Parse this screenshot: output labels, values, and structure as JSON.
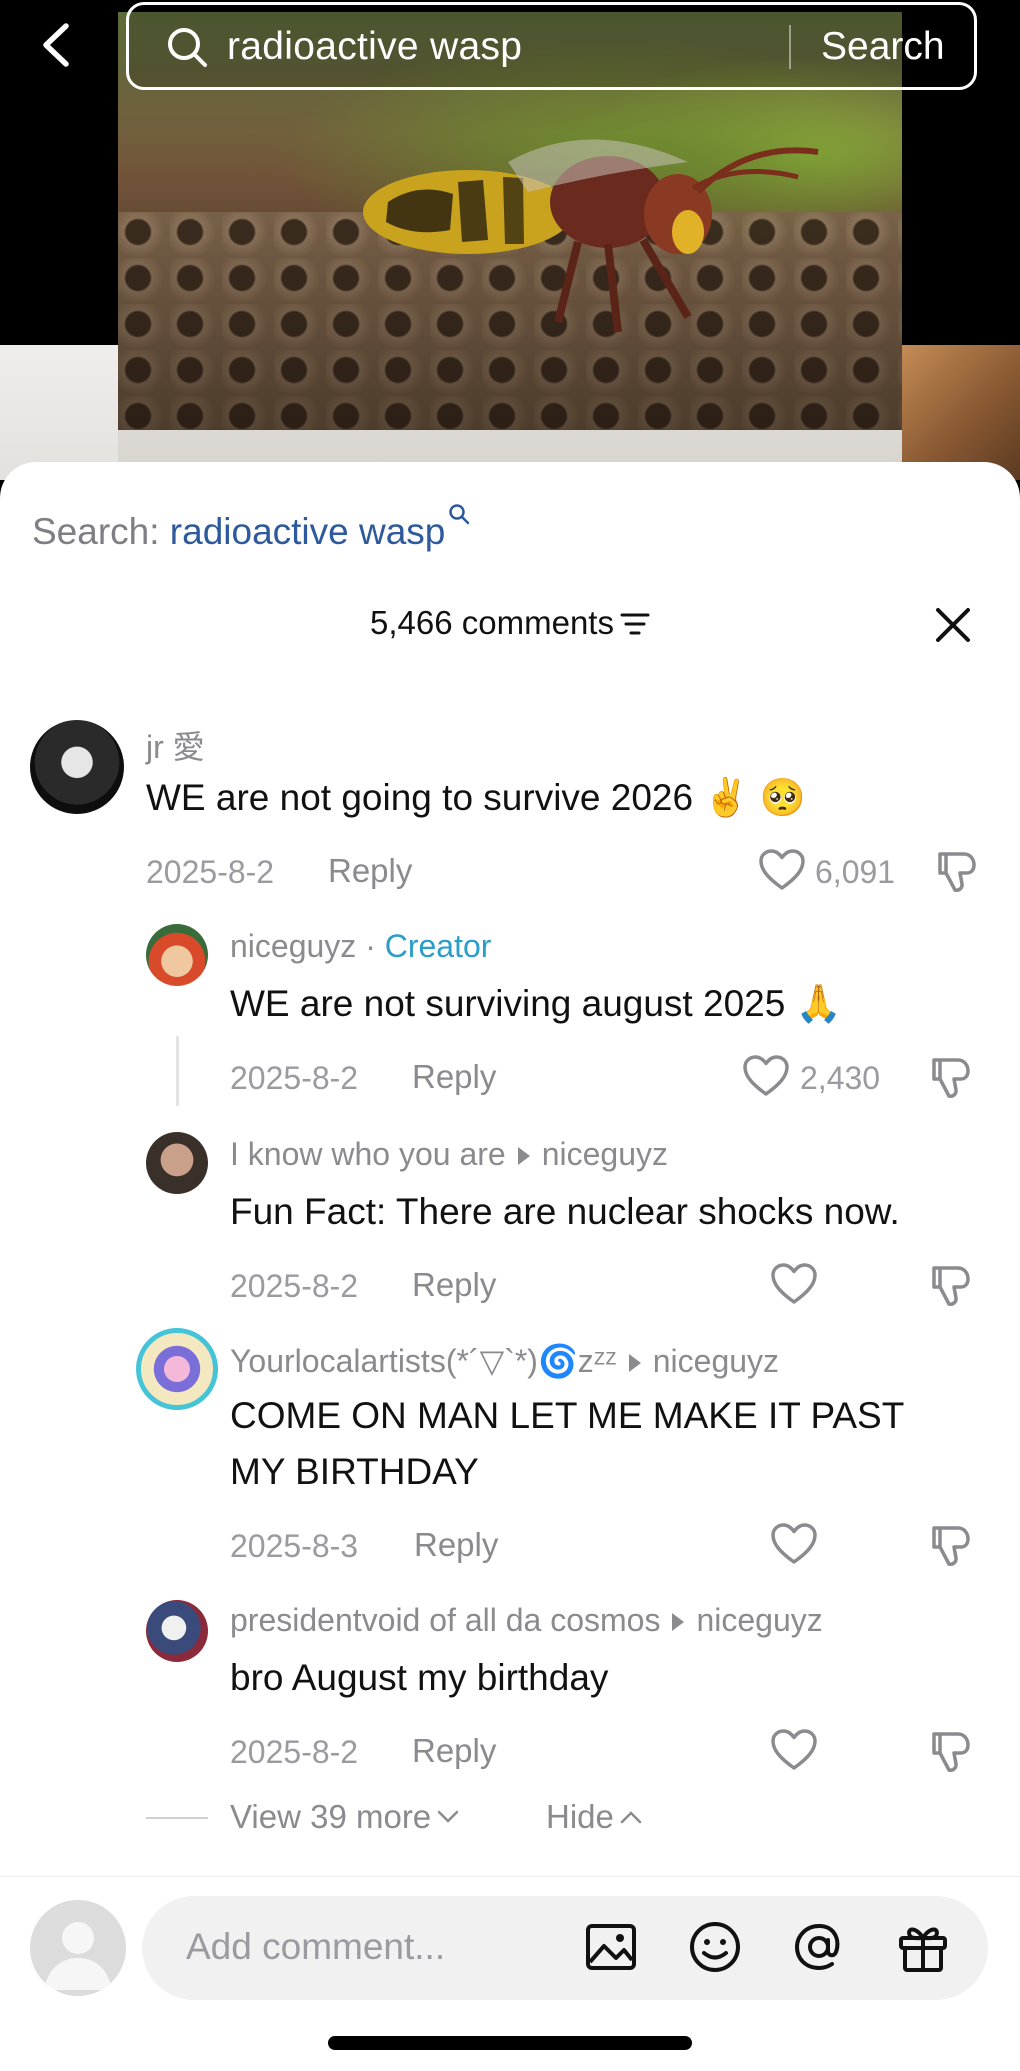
{
  "search": {
    "query": "radioactive wasp",
    "button_label": "Search"
  },
  "sheet": {
    "suggest_prefix": "Search: ",
    "suggest_term": "radioactive wasp",
    "comments_count_label": "5,466 comments"
  },
  "comments": [
    {
      "user": "jr 愛",
      "text": "WE are not going to survive 2026 ✌️ 🥺",
      "date": "2025-8-2",
      "reply_label": "Reply",
      "likes": "6,091"
    },
    {
      "user": "niceguyz",
      "badge": "Creator",
      "separator": " · ",
      "text": "WE are not surviving august 2025 🙏",
      "date": "2025-8-2",
      "reply_label": "Reply",
      "likes": "2,430"
    },
    {
      "user": "I know who you are",
      "reply_to": "niceguyz",
      "text": "Fun Fact: There are nuclear shocks now.",
      "date": "2025-8-2",
      "reply_label": "Reply",
      "likes": ""
    },
    {
      "user": "Yourlocalartists(*´▽`*)🌀zᶻᶻ",
      "reply_to": "niceguyz",
      "text_line1": "COME ON MAN LET ME MAKE IT PAST",
      "text_line2": "MY BIRTHDAY",
      "date": "2025-8-3",
      "reply_label": "Reply",
      "likes": ""
    },
    {
      "user": "presidentvoid of all da cosmos",
      "reply_to": "niceguyz",
      "text": "bro August my birthday",
      "date": "2025-8-2",
      "reply_label": "Reply",
      "likes": ""
    }
  ],
  "thread": {
    "view_more_label": "View 39 more",
    "hide_label": "Hide"
  },
  "composer": {
    "placeholder": "Add comment..."
  },
  "icons": [
    "back-arrow-icon",
    "search-icon",
    "sort-icon",
    "close-icon",
    "heart-icon",
    "dislike-icon",
    "chevron-down-icon",
    "chevron-up-icon",
    "image-icon",
    "emoji-icon",
    "mention-icon",
    "gift-icon"
  ],
  "colors": {
    "link_blue": "#2d5a9c",
    "creator_teal": "#2a9ec7",
    "text": "#111111",
    "muted": "#8a8a8f"
  }
}
